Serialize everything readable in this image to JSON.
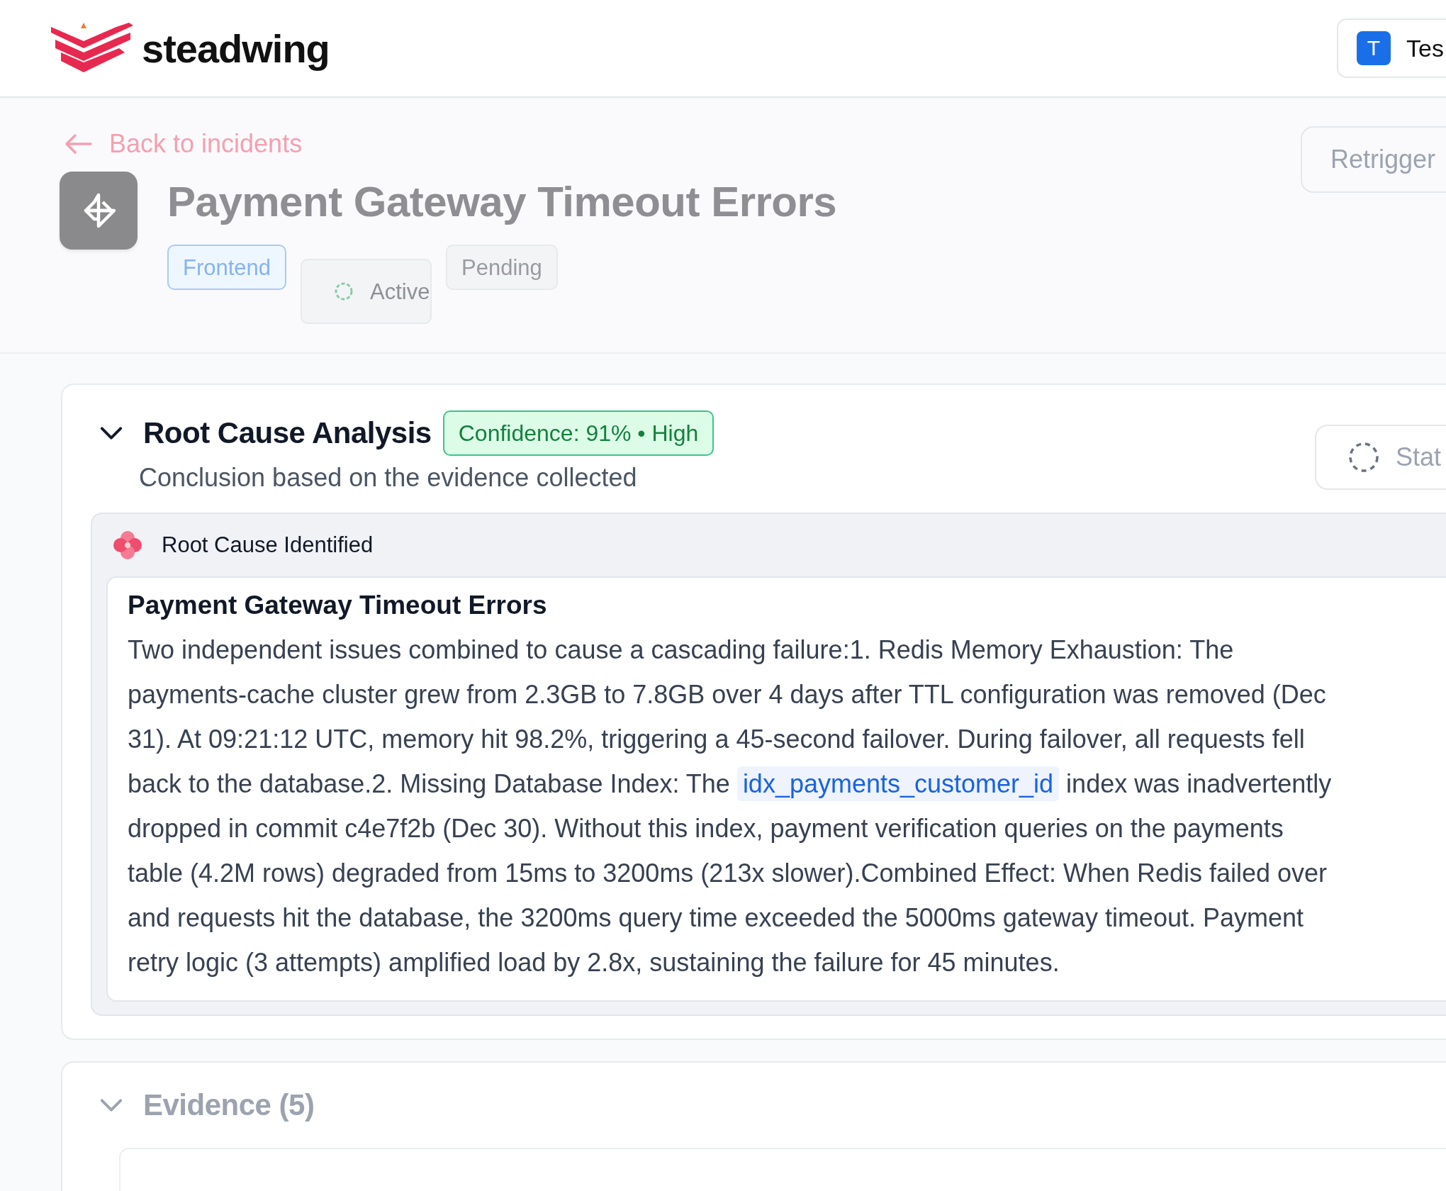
{
  "header": {
    "brand": "steadwing",
    "user": {
      "initial": "T",
      "name": "Tes"
    }
  },
  "back_link": {
    "label": "Back to incidents"
  },
  "actions": [
    {
      "label": "Retrigger"
    }
  ],
  "incident": {
    "title": "Payment Gateway Timeout Errors",
    "tags": [
      {
        "label": "Frontend",
        "kind": "team"
      },
      {
        "label": "Active",
        "kind": "status"
      },
      {
        "label": "Pending",
        "kind": "plain"
      }
    ]
  },
  "root_cause_analysis": {
    "title": "Root Cause Analysis",
    "expanded": true,
    "confidence": "Confidence: 91% • High",
    "subtitle": "Conclusion based on the evidence collected",
    "status_button": "Stat",
    "identified_label": "Root Cause Identified",
    "finding": {
      "title": "Payment Gateway Timeout Errors",
      "body": [
        {
          "kind": "text",
          "text": "Two independent issues combined to cause a cascading failure:1. Redis Memory Exhaustion: The payments-cache cluster grew from 2.3GB to 7.8GB over 4 days after TTL configuration was removed (Dec 31). At 09:21:12 UTC, memory hit 98.2%, triggering a 45-second failover. During failover, all requests fell back to the database.2. Missing Database Index: The "
        },
        {
          "kind": "code",
          "text": "idx_payments_customer_id"
        },
        {
          "kind": "text",
          "text": " index was inadvertently dropped in commit c4e7f2b (Dec 30). Without this index, payment verification queries on the payments table (4.2M rows) degraded from 15ms to 3200ms (213x slower).Combined Effect: When Redis failed over and requests hit the database, the 3200ms query time exceeded the 5000ms gateway timeout. Payment retry logic (3 attempts) amplified load by 2.8x, sustaining the failure for 45 minutes."
        }
      ]
    }
  },
  "evidence": {
    "title": "Evidence (5)",
    "expanded": true
  }
}
